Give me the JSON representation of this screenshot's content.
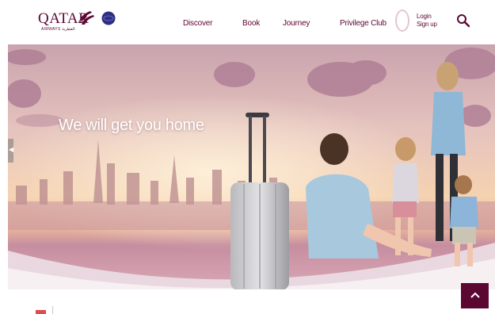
{
  "header": {
    "brand": {
      "wordmark": "QATAR",
      "subline": "AIRWAYS القطرية",
      "oryx_color": "#5c0632"
    },
    "alliance_logo": {
      "icon": "oneworld-icon",
      "color": "#2d2f84"
    },
    "nav": [
      {
        "label": "Discover"
      },
      {
        "label": "Book"
      },
      {
        "label": "Journey"
      },
      {
        "label": "Privilege Club"
      }
    ],
    "account": {
      "login_label": "Login",
      "signup_label": "Sign up"
    },
    "search": {
      "icon": "search-icon"
    }
  },
  "hero": {
    "headline": "We will get you home",
    "prev_icon": "chevron-left-icon"
  },
  "scroll_to_top": {
    "icon": "chevron-up-icon"
  },
  "colors": {
    "brand": "#5c0632",
    "sky_top": "#d9b4b9",
    "sky_mid": "#f0c8a8",
    "ground": "#c07b94"
  }
}
